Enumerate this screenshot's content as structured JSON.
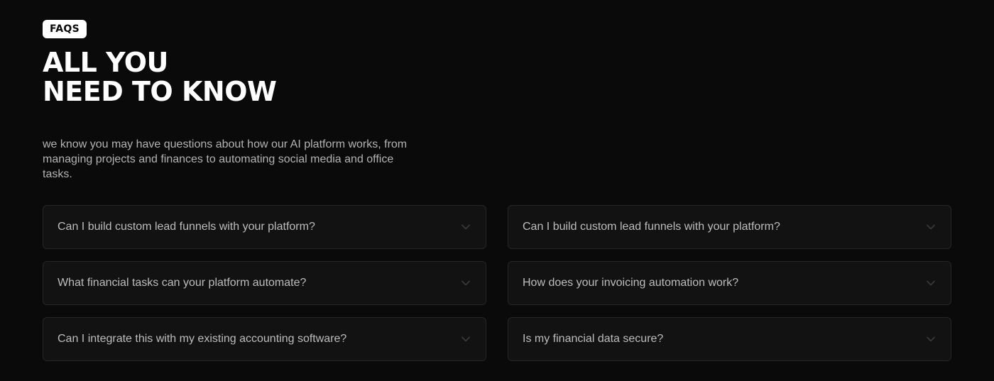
{
  "faq": {
    "badge": "FAQS",
    "headline": [
      "ALL YOU",
      "NEED TO KNOW"
    ],
    "intro": "we know you may have questions about how our AI platform works, from managing projects and finances to automating social media and office tasks.",
    "icon": "chevron-down-icon",
    "colors": {
      "background": "#0a0a0a",
      "card": "#121212",
      "card_border": "#262626",
      "text_muted": "#bdbdbd"
    },
    "items": [
      {
        "question": "Can I build custom lead funnels with your platform?"
      },
      {
        "question": "Can I build custom lead funnels with your platform?"
      },
      {
        "question": "What financial tasks can your platform automate?"
      },
      {
        "question": "How does your invoicing automation work?"
      },
      {
        "question": "Can I integrate this with my existing accounting software?"
      },
      {
        "question": "Is my financial data secure?"
      }
    ]
  }
}
